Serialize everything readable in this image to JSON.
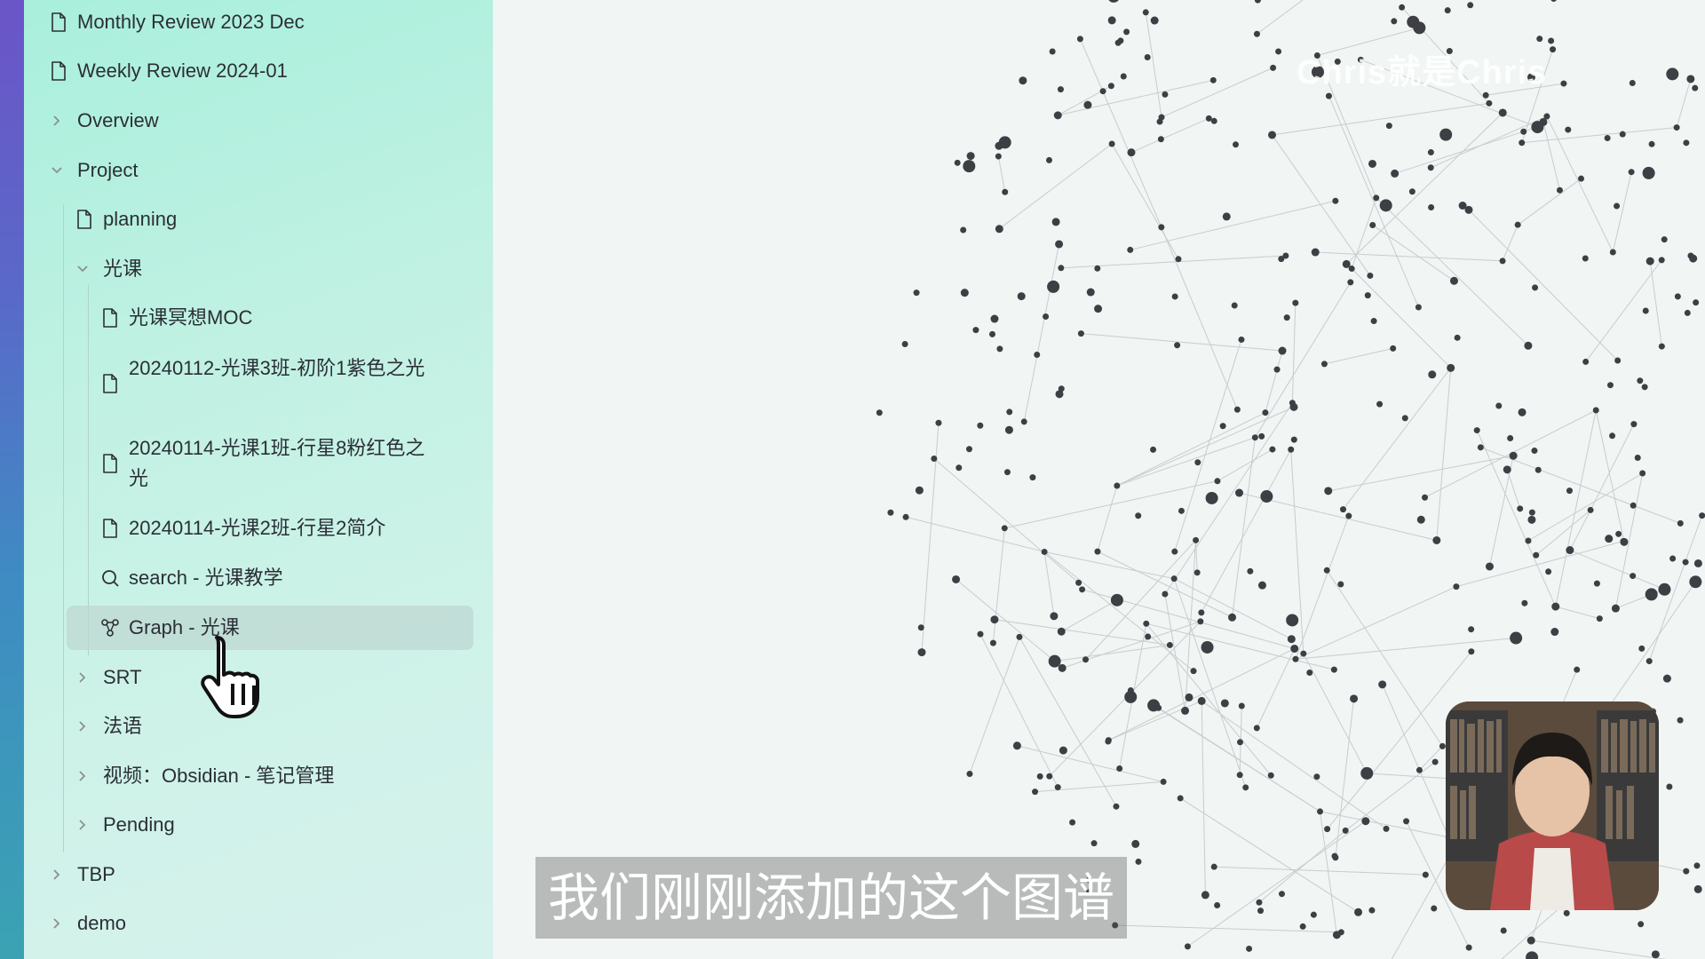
{
  "sidebar": {
    "items": [
      {
        "label": "Monthly Review 2023 Dec",
        "icon": "file-icon"
      },
      {
        "label": "Weekly Review 2024-01",
        "icon": "file-icon"
      },
      {
        "label": "Overview",
        "icon": "chevron-right-icon"
      },
      {
        "label": "Project",
        "icon": "chevron-down-icon"
      },
      {
        "label": "planning",
        "icon": "file-icon"
      },
      {
        "label": "光课",
        "icon": "chevron-down-icon"
      },
      {
        "label": "光课冥想MOC",
        "icon": "file-icon"
      },
      {
        "label": "20240112-光课3班-初阶1紫色之光",
        "icon": "file-icon"
      },
      {
        "label": "20240114-光课1班-行星8粉红色之光",
        "icon": "file-icon"
      },
      {
        "label": "20240114-光课2班-行星2简介",
        "icon": "file-icon"
      },
      {
        "label": "search - 光课教学",
        "icon": "search-icon"
      },
      {
        "label": "Graph - 光课",
        "icon": "graph-icon"
      },
      {
        "label": "SRT",
        "icon": "chevron-right-icon"
      },
      {
        "label": "法语",
        "icon": "chevron-right-icon"
      },
      {
        "label": "视频：Obsidian - 笔记管理",
        "icon": "chevron-right-icon"
      },
      {
        "label": "Pending",
        "icon": "chevron-right-icon"
      },
      {
        "label": "TBP",
        "icon": "chevron-right-icon"
      },
      {
        "label": "demo",
        "icon": "chevron-right-icon"
      }
    ]
  },
  "watermark": "Chris就是Chris",
  "subtitle": "我们刚刚添加的这个图谱",
  "colors": {
    "accent": "#a9efdc",
    "node": "#3d3f44",
    "edge": "#c9cccd"
  }
}
